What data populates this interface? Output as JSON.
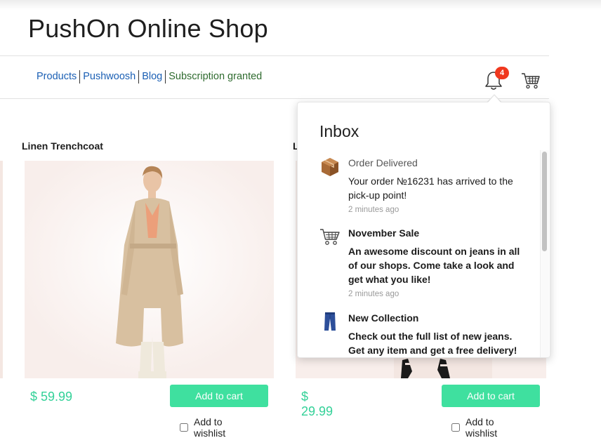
{
  "header": {
    "title": "PushOn Online Shop"
  },
  "nav": {
    "products": "Products",
    "pushwoosh": "Pushwoosh",
    "blog": "Blog",
    "status": "Subscription granted"
  },
  "notifications": {
    "badge_count": "4"
  },
  "products": [
    {
      "name": "Linen Trenchcoat",
      "price": "$ 59.99",
      "add_label": "Add to cart",
      "wishlist_label": "Add to wishlist"
    },
    {
      "name": "L",
      "price": "$ 29.99",
      "add_label": "Add to cart",
      "wishlist_label": "Add to wishlist"
    }
  ],
  "inbox": {
    "title": "Inbox",
    "messages": [
      {
        "title": "Order Delivered",
        "body": "Your order №16231 has arrived to the pick-up point!",
        "time": "2 minutes ago",
        "icon": "package-icon",
        "unread": false
      },
      {
        "title": "November Sale",
        "body": "An awesome discount on jeans in all of our shops. Come take a look and get what you like!",
        "time": "2 minutes ago",
        "icon": "shopping-cart-icon",
        "unread": true
      },
      {
        "title": "New Collection",
        "body": "Check out the full list of new jeans. Get any item and get a free delivery!",
        "time": "",
        "icon": "jeans-icon",
        "unread": true
      }
    ]
  },
  "colors": {
    "price": "#33d198",
    "button": "#3fe09f",
    "link": "#1a5fb4",
    "status": "#2f6b2f",
    "badge": "#f0381e"
  }
}
